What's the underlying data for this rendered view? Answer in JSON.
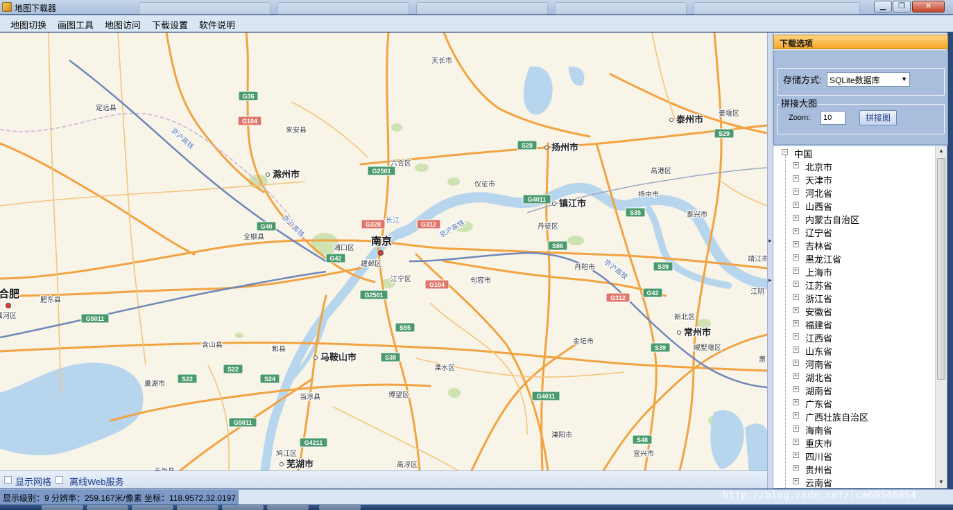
{
  "window": {
    "title": "地图下载器"
  },
  "menu": [
    "地图切换",
    "画图工具",
    "地图访问",
    "下载设置",
    "软件说明"
  ],
  "map": {
    "places": [
      {
        "name": "天长市",
        "kind": "city"
      },
      {
        "name": "定远县",
        "kind": "city"
      },
      {
        "name": "来安县",
        "kind": "city"
      },
      {
        "name": "滁州市",
        "kind": "major"
      },
      {
        "name": "六合区",
        "kind": "city"
      },
      {
        "name": "仪征市",
        "kind": "city"
      },
      {
        "name": "扬州市",
        "kind": "major"
      },
      {
        "name": "泰州市",
        "kind": "major"
      },
      {
        "name": "姜堰区",
        "kind": "city"
      },
      {
        "name": "高港区",
        "kind": "city"
      },
      {
        "name": "扬中市",
        "kind": "city"
      },
      {
        "name": "镇江市",
        "kind": "major"
      },
      {
        "name": "泰兴市",
        "kind": "city"
      },
      {
        "name": "全椒县",
        "kind": "city"
      },
      {
        "name": "浦口区",
        "kind": "city"
      },
      {
        "name": "南京",
        "kind": "capital"
      },
      {
        "name": "建邺区",
        "kind": "city"
      },
      {
        "name": "江宁区",
        "kind": "city"
      },
      {
        "name": "句容市",
        "kind": "city"
      },
      {
        "name": "丹徒区",
        "kind": "city"
      },
      {
        "name": "丹阳市",
        "kind": "city"
      },
      {
        "name": "靖江市",
        "kind": "city"
      },
      {
        "name": "合肥",
        "kind": "capital"
      },
      {
        "name": "肥东县",
        "kind": "city"
      },
      {
        "name": "瑶河区",
        "kind": "city"
      },
      {
        "name": "江阴",
        "kind": "city"
      },
      {
        "name": "新北区",
        "kind": "city"
      },
      {
        "name": "常州市",
        "kind": "major"
      },
      {
        "name": "戚墅堰区",
        "kind": "city"
      },
      {
        "name": "含山县",
        "kind": "city"
      },
      {
        "name": "和县",
        "kind": "city"
      },
      {
        "name": "马鞍山市",
        "kind": "major"
      },
      {
        "name": "金坛市",
        "kind": "city"
      },
      {
        "name": "溧水区",
        "kind": "city"
      },
      {
        "name": "巢湖市",
        "kind": "city"
      },
      {
        "name": "当涂县",
        "kind": "city"
      },
      {
        "name": "博望区",
        "kind": "city"
      },
      {
        "name": "溧阳市",
        "kind": "city"
      },
      {
        "name": "宜兴市",
        "kind": "city"
      },
      {
        "name": "鸠江区",
        "kind": "city"
      },
      {
        "name": "芜湖市",
        "kind": "major"
      },
      {
        "name": "高淳区",
        "kind": "city"
      },
      {
        "name": "无为县",
        "kind": "city"
      },
      {
        "name": "惠",
        "kind": "city"
      },
      {
        "name": "长江",
        "kind": "river"
      },
      {
        "name": "京沪高铁",
        "kind": "rail"
      },
      {
        "name": "京沪高铁",
        "kind": "rail"
      },
      {
        "name": "京沪高铁",
        "kind": "rail"
      },
      {
        "name": "京沪高铁",
        "kind": "rail"
      }
    ],
    "shields": [
      {
        "code": "G36",
        "color": "#4a9a6e"
      },
      {
        "code": "G104",
        "color": "#e0766a"
      },
      {
        "code": "G2501",
        "color": "#4a9a6e"
      },
      {
        "code": "S28",
        "color": "#4a9a6e"
      },
      {
        "code": "S29",
        "color": "#4a9a6e"
      },
      {
        "code": "G4011",
        "color": "#4a9a6e"
      },
      {
        "code": "S35",
        "color": "#4a9a6e"
      },
      {
        "code": "G40",
        "color": "#4a9a6e"
      },
      {
        "code": "G328",
        "color": "#e0766a"
      },
      {
        "code": "G312",
        "color": "#e0766a"
      },
      {
        "code": "G42",
        "color": "#4a9a6e"
      },
      {
        "code": "S86",
        "color": "#4a9a6e"
      },
      {
        "code": "S39",
        "color": "#4a9a6e"
      },
      {
        "code": "G104",
        "color": "#e0766a"
      },
      {
        "code": "G312",
        "color": "#e0766a"
      },
      {
        "code": "G42",
        "color": "#4a9a6e"
      },
      {
        "code": "G2501",
        "color": "#4a9a6e"
      },
      {
        "code": "G5011",
        "color": "#4a9a6e"
      },
      {
        "code": "S55",
        "color": "#4a9a6e"
      },
      {
        "code": "S39",
        "color": "#4a9a6e"
      },
      {
        "code": "S38",
        "color": "#4a9a6e"
      },
      {
        "code": "S22",
        "color": "#4a9a6e"
      },
      {
        "code": "S22",
        "color": "#4a9a6e"
      },
      {
        "code": "S24",
        "color": "#4a9a6e"
      },
      {
        "code": "G4011",
        "color": "#4a9a6e"
      },
      {
        "code": "G5011",
        "color": "#4a9a6e"
      },
      {
        "code": "G4211",
        "color": "#4a9a6e"
      },
      {
        "code": "S48",
        "color": "#4a9a6e"
      }
    ]
  },
  "footer": {
    "show_grid": {
      "label": "显示网格",
      "checked": false
    },
    "offline_web": {
      "label": "离线Web服务",
      "checked": false
    }
  },
  "panel": {
    "header": "下载选项",
    "storage_label": "存储方式:",
    "storage_value": "SQLite数据库",
    "stitch_legend": "拼接大图",
    "zoom_label": "Zoom:",
    "zoom_value": "10",
    "stitch_button": "拼接图"
  },
  "tree": {
    "root": "中国",
    "items": [
      "北京市",
      "天津市",
      "河北省",
      "山西省",
      "内蒙古自治区",
      "辽宁省",
      "吉林省",
      "黑龙江省",
      "上海市",
      "江苏省",
      "浙江省",
      "安徽省",
      "福建省",
      "江西省",
      "山东省",
      "河南省",
      "湖北省",
      "湖南省",
      "广东省",
      "广西壮族自治区",
      "海南省",
      "重庆市",
      "四川省",
      "贵州省",
      "云南省"
    ]
  },
  "status": {
    "text": "显示级别：9 分辨率：259.167米/像素 坐标：118.9572,32.0197"
  },
  "watermark": "http://blog.csdn.net/lcm60546054",
  "colors": {
    "accent_header": "#f6a826",
    "road": "#f2a341",
    "water": "#b7d6ee",
    "land": "#f8f4e8",
    "green": "#cfe3b2"
  }
}
